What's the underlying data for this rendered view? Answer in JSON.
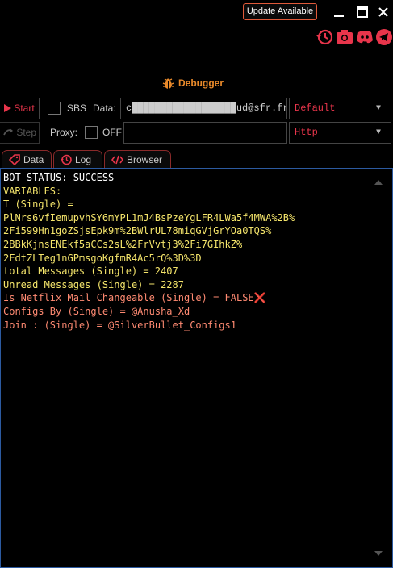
{
  "titlebar": {
    "update_label": "Update Available"
  },
  "header": {
    "title": "Debugger"
  },
  "row1": {
    "start_label": "Start",
    "sbs_label": "SBS",
    "data_label": "Data:",
    "data_value": "c██████████████████ud@sfr.fr:Finette",
    "wordlist_select": "Default"
  },
  "row2": {
    "step_label": "Step",
    "proxy_label": "Proxy:",
    "proxy_toggle": "OFF",
    "proxy_value": "",
    "proxy_type_select": "Http"
  },
  "tabs": [
    {
      "label": "Data"
    },
    {
      "label": "Log"
    },
    {
      "label": "Browser"
    }
  ],
  "console": {
    "lines": [
      {
        "text": "BOT STATUS: SUCCESS",
        "color": "#ffffff"
      },
      {
        "text": "VARIABLES:",
        "color": "#f5e56b"
      },
      {
        "text": "T (Single) =",
        "color": "#f5e56b"
      },
      {
        "text": "PlNrs6vfIemupvhSY6mYPL1mJ4BsPzeYgLFR4LWa5f4MWA%2B%",
        "color": "#f5e56b"
      },
      {
        "text": "2Fi599Hn1goZSjsEpk9m%2BWlrUL78miqGVjGrYOa0TQS%",
        "color": "#f5e56b"
      },
      {
        "text": "2BBkKjnsENEkf5aCCs2sL%2FrVvtj3%2Fi7GIhkZ%",
        "color": "#f5e56b"
      },
      {
        "text": "2FdtZLTeg1nGPmsgoKgfmR4Ac5rQ%3D%3D",
        "color": "#f5e56b"
      },
      {
        "text": "total Messages (Single) = 2407",
        "color": "#f5e56b"
      },
      {
        "text": "Unread Messages (Single) = 2287",
        "color": "#f5e56b"
      },
      {
        "text": "Is Netflix Mail Changeable (Single) = FALSE❌",
        "color": "#ff8a72"
      },
      {
        "text": "Configs By (Single) = @Anusha_Xd",
        "color": "#ff8a72"
      },
      {
        "text": "Join : (Single) = @SilverBullet_Configs1",
        "color": "#ff8a72"
      }
    ]
  },
  "colors": {
    "accent_red": "#e8354b",
    "header_orange": "#e8892a",
    "console_border": "#2c5aa0"
  },
  "icons": [
    "history-icon",
    "camera-icon",
    "discord-icon",
    "telegram-icon",
    "bug-icon",
    "play-icon",
    "step-icon",
    "log-icon",
    "code-icon",
    "chevron-down-icon",
    "minimize-icon",
    "maximize-icon",
    "close-icon"
  ]
}
